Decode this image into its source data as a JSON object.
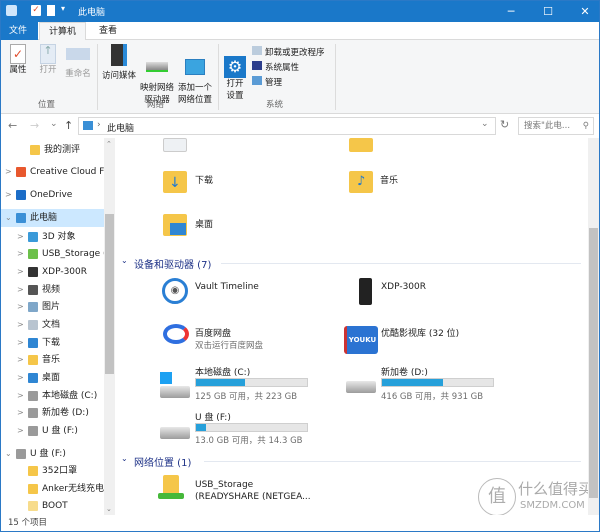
{
  "window": {
    "title": "此电脑",
    "minimize": "─",
    "maximize": "☐",
    "close": "✕"
  },
  "ribbon_tabs": [
    "文件",
    "计算机",
    "查看"
  ],
  "ribbon": {
    "location": {
      "label": "位置",
      "buttons": [
        "属性",
        "打开",
        "重命名"
      ]
    },
    "network": {
      "label": "网络",
      "buttons": [
        "访问媒体",
        "映射网络\n驱动器",
        "添加一个\n网络位置"
      ]
    },
    "system": {
      "label": "系统",
      "open_settings": "打开\n设置",
      "small": [
        "卸载或更改程序",
        "系统属性",
        "管理"
      ]
    }
  },
  "address": {
    "back": "←",
    "forward": "→",
    "recent": "⌄",
    "up": "↑",
    "sep": "›",
    "path": "此电脑",
    "dropdown": "⌄",
    "refresh": "↻",
    "search_placeholder": "搜索\"此电...",
    "search_icon": "⚲"
  },
  "sidebar": {
    "items": [
      {
        "label": "我的测评",
        "icon": "folder-icon",
        "color": "#f5c649"
      },
      {
        "label": "Creative Cloud F",
        "icon": "creative-cloud-icon",
        "color": "#e8582e"
      },
      {
        "label": "OneDrive",
        "icon": "onedrive-icon",
        "color": "#1c6dc7"
      },
      {
        "label": "此电脑",
        "icon": "computer-icon",
        "color": "#3a8fd6"
      },
      {
        "label": "3D 对象",
        "icon": "3d-objects-icon",
        "color": "#3a9ad9"
      },
      {
        "label": "USB_Storage (F",
        "icon": "network-folder-icon",
        "color": "#6cc04a"
      },
      {
        "label": "XDP-300R",
        "icon": "player-icon",
        "color": "#333333"
      },
      {
        "label": "视频",
        "icon": "videos-icon",
        "color": "#555555"
      },
      {
        "label": "图片",
        "icon": "pictures-icon",
        "color": "#7fa7c9"
      },
      {
        "label": "文档",
        "icon": "documents-icon",
        "color": "#b8c4d0"
      },
      {
        "label": "下载",
        "icon": "downloads-icon",
        "color": "#2f86d3"
      },
      {
        "label": "音乐",
        "icon": "music-icon",
        "color": "#f5c649"
      },
      {
        "label": "桌面",
        "icon": "desktop-icon",
        "color": "#2f86d3"
      },
      {
        "label": "本地磁盘 (C:)",
        "icon": "drive-c-icon",
        "color": "#9a9a9a"
      },
      {
        "label": "新加卷 (D:)",
        "icon": "drive-icon",
        "color": "#9a9a9a"
      },
      {
        "label": "U 盘 (F:)",
        "icon": "usb-drive-icon",
        "color": "#9a9a9a"
      },
      {
        "label": "U 盘 (F:)",
        "icon": "usb-drive-icon",
        "color": "#9a9a9a"
      },
      {
        "label": "352口罩",
        "icon": "folder-icon",
        "color": "#f5c649"
      },
      {
        "label": "Anker无线充电器",
        "icon": "folder-icon",
        "color": "#f5c649"
      },
      {
        "label": "BOOT",
        "icon": "folder-icon",
        "color": "#f7dc8c"
      }
    ]
  },
  "main": {
    "folders": [
      {
        "name": "下载"
      },
      {
        "name": "音乐"
      },
      {
        "name": "桌面"
      }
    ],
    "devices_header": "设备和驱动器 (7)",
    "devices": [
      {
        "name": "Vault Timeline"
      },
      {
        "name": "XDP-300R"
      },
      {
        "name": "百度网盘",
        "sub": "双击运行百度网盘"
      },
      {
        "name": "优酷影视库 (32 位)",
        "logo": "YOUKU"
      }
    ],
    "drives": [
      {
        "name": "本地磁盘 (C:)",
        "free": "125 GB 可用，共 223 GB",
        "used_fraction": 0.44
      },
      {
        "name": "新加卷 (D:)",
        "free": "416 GB 可用，共 931 GB",
        "used_fraction": 0.55
      },
      {
        "name": "U 盘 (F:)",
        "free": "13.0 GB 可用，共 14.3 GB",
        "used_fraction": 0.09
      }
    ],
    "network_header": "网络位置 (1)",
    "network": [
      {
        "name": "USB_Storage",
        "sub": "(READYSHARE (NETGEA..."
      }
    ]
  },
  "status": "15 个项目",
  "watermark": {
    "text": "什么值得买",
    "sub": "SMZDM.COM"
  }
}
